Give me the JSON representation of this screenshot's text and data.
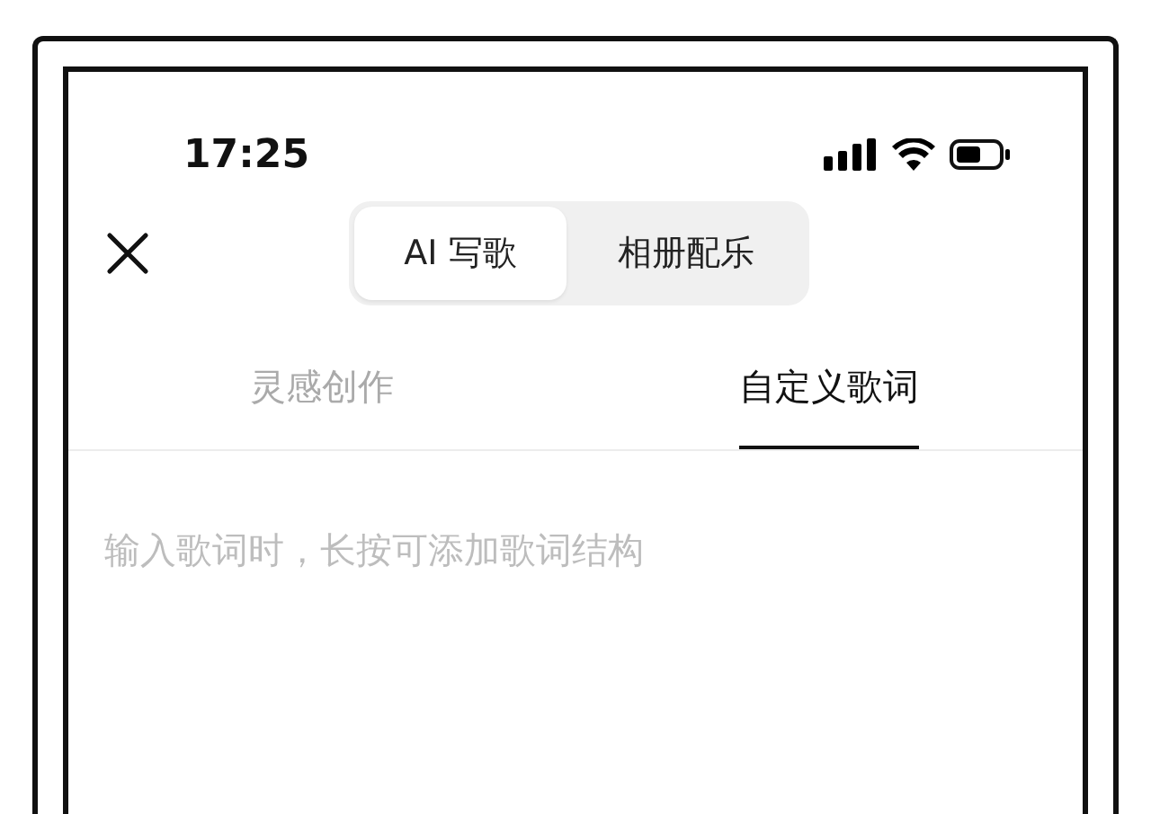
{
  "status_bar": {
    "time": "17:25"
  },
  "header": {
    "segments": [
      {
        "label": "AI 写歌",
        "selected": true
      },
      {
        "label": "相册配乐",
        "selected": false
      }
    ]
  },
  "tabs": [
    {
      "label": "灵感创作",
      "selected": false
    },
    {
      "label": "自定义歌词",
      "selected": true
    }
  ],
  "editor": {
    "placeholder": "输入歌词时，长按可添加歌词结构"
  }
}
